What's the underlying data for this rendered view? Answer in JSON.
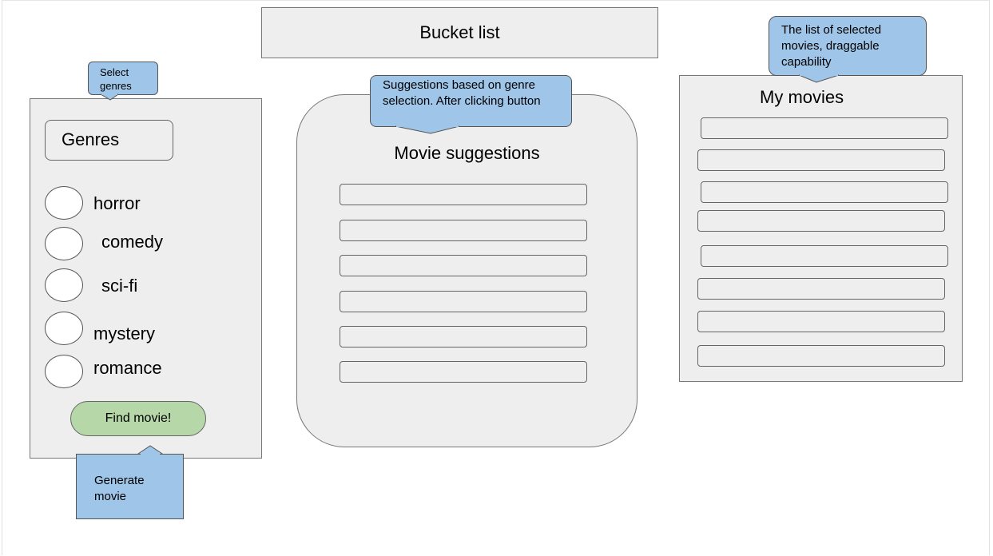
{
  "title": "Bucket list",
  "genres": {
    "header": "Genres",
    "options": [
      "horror",
      "comedy",
      "sci-fi",
      "mystery",
      "romance"
    ],
    "button_label": "Find movie!"
  },
  "suggestions": {
    "title": "Movie suggestions",
    "slot_count": 6
  },
  "my_movies": {
    "title": "My movies",
    "slot_count": 8
  },
  "callouts": {
    "select_genres": "Select genres",
    "generate_movie": "Generate movie",
    "suggestions_note": "Suggestions based on genre selection. After clicking button",
    "my_movies_note": "The list of selected movies, draggable capability"
  },
  "colors": {
    "panel": "#eeeeee",
    "callout": "#9fc5e8",
    "button": "#b6d7a8"
  }
}
